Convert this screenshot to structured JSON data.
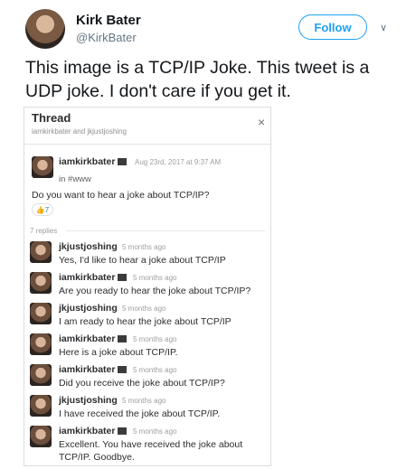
{
  "tweet": {
    "author_name": "Kirk Bater",
    "author_handle": "@KirkBater",
    "follow_label": "Follow",
    "text_line1": "This image is a TCP/IP Joke.  This tweet is a",
    "text_line2": "UDP joke.  I don't care if you get it."
  },
  "thread": {
    "title": "Thread",
    "subtitle": "iamkirkbater and jkjustjoshing",
    "close": "×",
    "root": {
      "user": "iamkirkbater",
      "timestamp": "Aug 23rd, 2017 at 9:37 AM",
      "channel": "in #www",
      "text": "Do you want to hear a joke about TCP/IP?",
      "reaction_count": "7"
    },
    "replies_label": "7 replies",
    "replies": [
      {
        "user": "jkjustjoshing",
        "time": "5 months ago",
        "text": "Yes, I'd like to hear a joke about TCP/IP"
      },
      {
        "user": "iamkirkbater",
        "time": "5 months ago",
        "text": "Are you ready to hear the joke about TCP/IP?"
      },
      {
        "user": "jkjustjoshing",
        "time": "5 months ago",
        "text": "I am ready to hear the joke about TCP/IP"
      },
      {
        "user": "iamkirkbater",
        "time": "5 months ago",
        "text": "Here is a joke about TCP/IP."
      },
      {
        "user": "iamkirkbater",
        "time": "5 months ago",
        "text": "Did you receive the joke about TCP/IP?"
      },
      {
        "user": "jkjustjoshing",
        "time": "5 months ago",
        "text": "I have received the joke about TCP/IP."
      },
      {
        "user": "iamkirkbater",
        "time": "5 months ago",
        "text": "Excellent.  You have received the joke about",
        "text2": "TCP/IP.  Goodbye."
      }
    ]
  }
}
